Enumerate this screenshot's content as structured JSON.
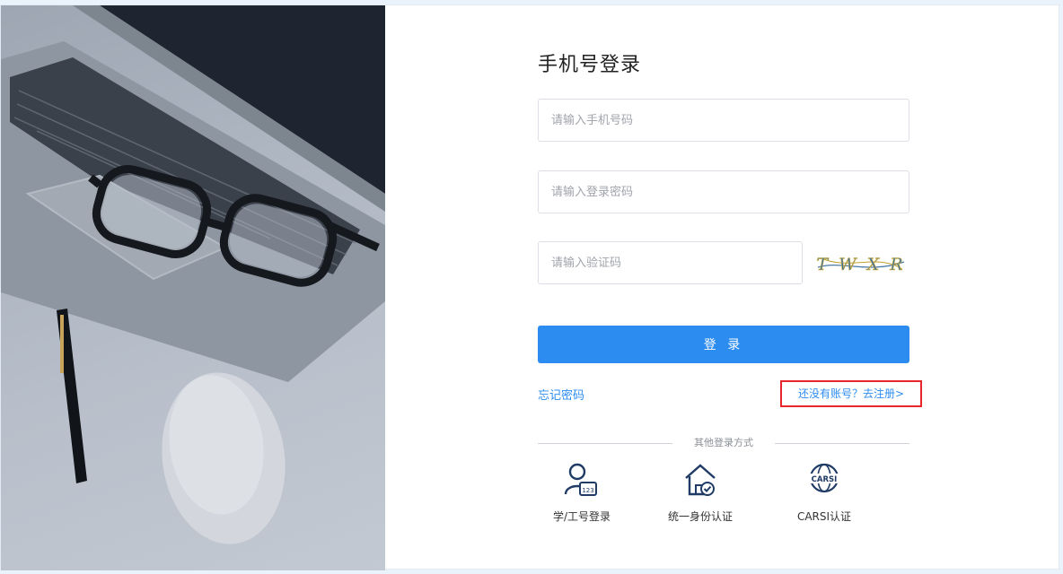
{
  "login": {
    "title": "手机号登录",
    "phone_placeholder": "请输入手机号码",
    "password_placeholder": "请输入登录密码",
    "captcha_placeholder": "请输入验证码",
    "captcha_text": "T W X R",
    "submit_label": "登 录",
    "forgot_label": "忘记密码",
    "register_label": "还没有账号？去注册>",
    "other_methods_label": "其他登录方式"
  },
  "other_methods": [
    {
      "label": "学/工号登录",
      "icon": "student-id-icon"
    },
    {
      "label": "统一身份认证",
      "icon": "house-check-icon"
    },
    {
      "label": "CARSI认证",
      "icon": "carsi-globe-icon",
      "icon_text": "CARSI"
    }
  ],
  "colors": {
    "primary": "#2d8cf0",
    "highlight_border": "#e8272d",
    "page_background": "#eaf2fb"
  }
}
